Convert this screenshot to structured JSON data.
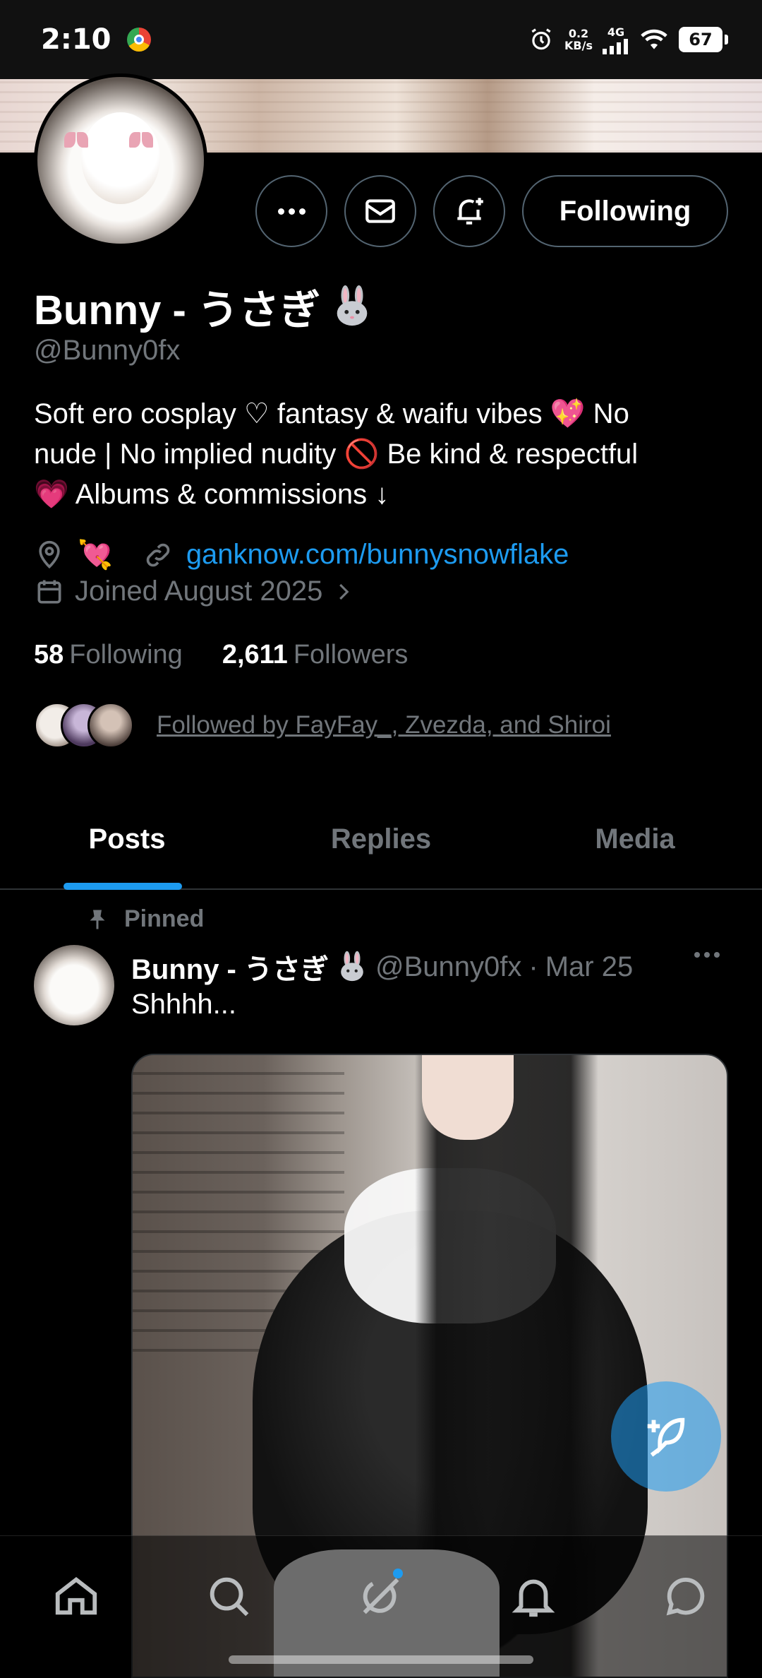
{
  "status_bar": {
    "time": "2:10",
    "speed_value": "0.2",
    "speed_unit": "KB/s",
    "network": "4G",
    "battery": "67"
  },
  "profile": {
    "display_name": "Bunny - うさぎ",
    "handle": "@Bunny0fx",
    "follow_button": "Following",
    "bio_line1": "Soft ero cosplay ♡ fantasy & waifu vibes 💖 No",
    "bio_line2": "nude | No implied nudity 🚫 Be kind & respectful",
    "bio_line3": "💗 Albums & commissions ↓",
    "location_emoji": "💘",
    "website": "ganknow.com/bunnysnowflake",
    "joined": "Joined August 2025",
    "following_count": "58",
    "following_label": "Following",
    "followers_count": "2,611",
    "followers_label": "Followers",
    "followed_by": "Followed by FayFay_, Zvezda, and Shiroi"
  },
  "tabs": [
    {
      "label": "Posts",
      "active": true
    },
    {
      "label": "Replies",
      "active": false
    },
    {
      "label": "Media",
      "active": false
    }
  ],
  "post": {
    "pinned_label": "Pinned",
    "author_name": "Bunny - うさぎ",
    "author_handle": "@Bunny0fx",
    "separator": "·",
    "date": "Mar 25",
    "text": "Shhhh..."
  },
  "bottom_nav": [
    "home-icon",
    "search-icon",
    "grok-icon",
    "notifications-icon",
    "messages-icon"
  ],
  "colors": {
    "accent": "#1d9bf0",
    "background": "#000000",
    "muted_text": "#71767b"
  }
}
